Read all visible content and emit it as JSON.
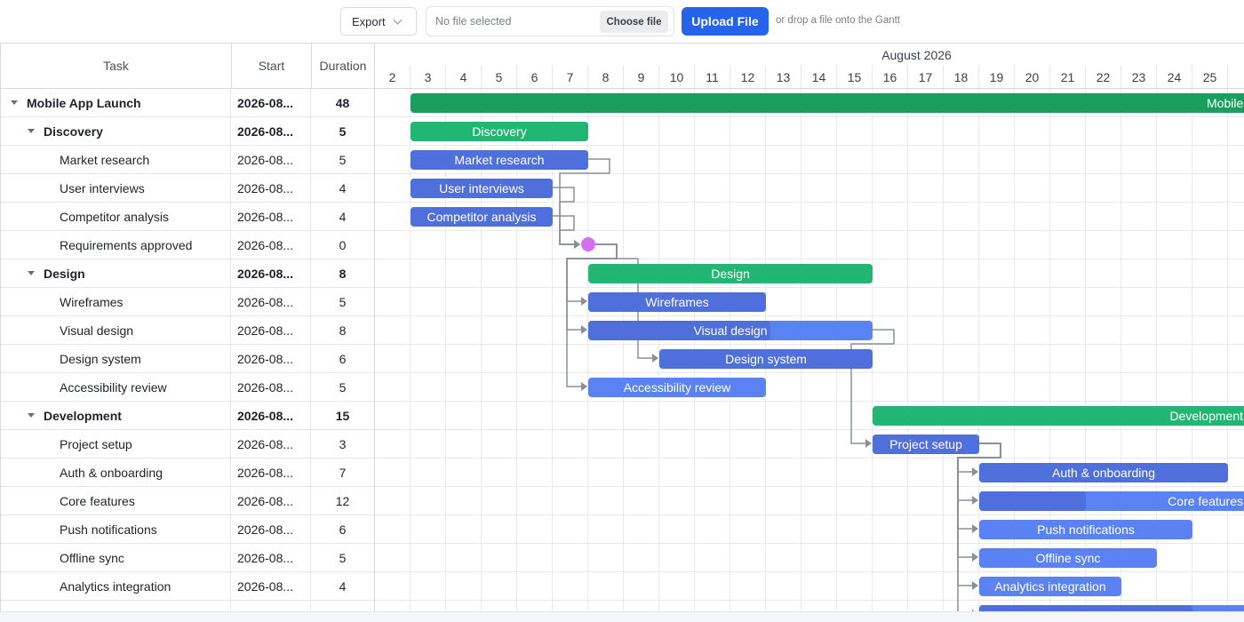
{
  "toolbar": {
    "export_label": "Export",
    "file_status": "No file selected",
    "choose_label": "Choose file",
    "upload_label": "Upload File",
    "drop_hint": "or drop a file onto the Gantt"
  },
  "grid": {
    "columns": {
      "task": "Task",
      "start": "Start",
      "duration": "Duration"
    }
  },
  "timeline": {
    "month": "August 2026",
    "first_day": 2,
    "days": [
      "2",
      "3",
      "4",
      "5",
      "6",
      "7",
      "8",
      "9",
      "10",
      "11",
      "12",
      "13",
      "14",
      "15",
      "16",
      "17",
      "18",
      "19",
      "20",
      "21",
      "22",
      "23",
      "24",
      "25"
    ]
  },
  "colors": {
    "summary": "#22b573",
    "project": "#1a9e5e",
    "task": "#4f6fdc",
    "task_light": "#5a82f2",
    "milestone": "#d66ef0",
    "link": "#8a8f98"
  },
  "tasks": [
    {
      "id": "t0",
      "name": "Mobile App Launch",
      "start": "2026-08...",
      "duration": "48",
      "level": 0,
      "type": "project",
      "expanded": true,
      "day_start": 3,
      "days": 48,
      "progress": 0.95,
      "label": "Mobile App Launch"
    },
    {
      "id": "t1",
      "name": "Discovery",
      "start": "2026-08...",
      "duration": "5",
      "level": 1,
      "type": "summary",
      "expanded": true,
      "day_start": 3,
      "days": 5,
      "progress": 1,
      "label": "Discovery"
    },
    {
      "id": "t2",
      "name": "Market research",
      "start": "2026-08...",
      "duration": "5",
      "level": 2,
      "type": "task",
      "day_start": 3,
      "days": 5,
      "progress": 1,
      "label": "Market research"
    },
    {
      "id": "t3",
      "name": "User interviews",
      "start": "2026-08...",
      "duration": "4",
      "level": 2,
      "type": "task",
      "day_start": 3,
      "days": 4,
      "progress": 1,
      "label": "User interviews"
    },
    {
      "id": "t4",
      "name": "Competitor analysis",
      "start": "2026-08...",
      "duration": "4",
      "level": 2,
      "type": "task",
      "day_start": 3,
      "days": 4,
      "progress": 1,
      "label": "Competitor analysis"
    },
    {
      "id": "t5",
      "name": "Requirements approved",
      "start": "2026-08...",
      "duration": "0",
      "level": 2,
      "type": "milestone",
      "day_start": 8,
      "days": 0,
      "progress": 0,
      "label": ""
    },
    {
      "id": "t6",
      "name": "Design",
      "start": "2026-08...",
      "duration": "8",
      "level": 1,
      "type": "summary",
      "expanded": true,
      "day_start": 8,
      "days": 8,
      "progress": 1,
      "label": "Design"
    },
    {
      "id": "t7",
      "name": "Wireframes",
      "start": "2026-08...",
      "duration": "5",
      "level": 2,
      "type": "task",
      "day_start": 8,
      "days": 5,
      "progress": 1,
      "label": "Wireframes"
    },
    {
      "id": "t8",
      "name": "Visual design",
      "start": "2026-08...",
      "duration": "8",
      "level": 2,
      "type": "task",
      "day_start": 8,
      "days": 8,
      "progress": 0.64,
      "label": "Visual design"
    },
    {
      "id": "t9",
      "name": "Design system",
      "start": "2026-08...",
      "duration": "6",
      "level": 2,
      "type": "task",
      "day_start": 10,
      "days": 6,
      "progress": 1,
      "label": "Design system"
    },
    {
      "id": "t10",
      "name": "Accessibility review",
      "start": "2026-08...",
      "duration": "5",
      "level": 2,
      "type": "task",
      "day_start": 8,
      "days": 5,
      "progress": 0,
      "label": "Accessibility review"
    },
    {
      "id": "t11",
      "name": "Development",
      "start": "2026-08...",
      "duration": "15",
      "level": 1,
      "type": "summary",
      "expanded": true,
      "day_start": 16,
      "days": 15,
      "progress": 1,
      "label": "Development"
    },
    {
      "id": "t12",
      "name": "Project setup",
      "start": "2026-08...",
      "duration": "3",
      "level": 2,
      "type": "task",
      "day_start": 16,
      "days": 3,
      "progress": 1,
      "label": "Project setup"
    },
    {
      "id": "t13",
      "name": "Auth & onboarding",
      "start": "2026-08...",
      "duration": "7",
      "level": 2,
      "type": "task",
      "day_start": 19,
      "days": 7,
      "progress": 1,
      "label": "Auth & onboarding"
    },
    {
      "id": "t14",
      "name": "Core features",
      "start": "2026-08...",
      "duration": "12",
      "level": 2,
      "type": "task",
      "day_start": 19,
      "days": 12,
      "progress": 0.25,
      "label": "Core features"
    },
    {
      "id": "t15",
      "name": "Push notifications",
      "start": "2026-08...",
      "duration": "6",
      "level": 2,
      "type": "task",
      "day_start": 19,
      "days": 6,
      "progress": 0,
      "label": "Push notifications"
    },
    {
      "id": "t16",
      "name": "Offline sync",
      "start": "2026-08...",
      "duration": "5",
      "level": 2,
      "type": "task",
      "day_start": 19,
      "days": 5,
      "progress": 0,
      "label": "Offline sync"
    },
    {
      "id": "t17",
      "name": "Analytics integration",
      "start": "2026-08...",
      "duration": "4",
      "level": 2,
      "type": "task",
      "day_start": 19,
      "days": 4,
      "progress": 0,
      "label": "Analytics integration"
    },
    {
      "id": "t18",
      "name": "",
      "start": "",
      "duration": "",
      "level": 2,
      "type": "task",
      "day_start": 19,
      "days": 12,
      "progress": 0.5,
      "label": ""
    }
  ],
  "links": [
    [
      "t2",
      "t5"
    ],
    [
      "t3",
      "t5"
    ],
    [
      "t4",
      "t5"
    ],
    [
      "t5",
      "t7"
    ],
    [
      "t5",
      "t8"
    ],
    [
      "t5",
      "t9"
    ],
    [
      "t5",
      "t10"
    ],
    [
      "t8",
      "t12"
    ],
    [
      "t12",
      "t13"
    ],
    [
      "t12",
      "t14"
    ],
    [
      "t12",
      "t15"
    ],
    [
      "t12",
      "t16"
    ],
    [
      "t12",
      "t17"
    ],
    [
      "t12",
      "t18"
    ]
  ]
}
